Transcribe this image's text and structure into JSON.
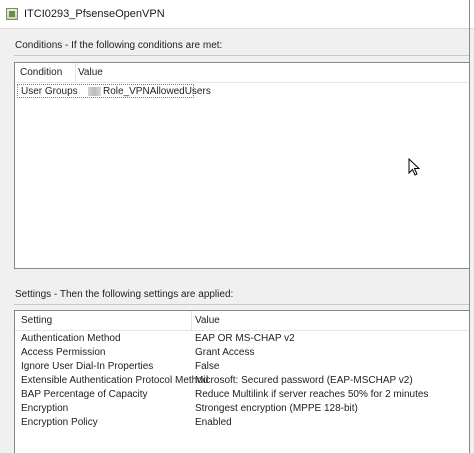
{
  "window": {
    "title": "ITCI0293_PfsenseOpenVPN"
  },
  "conditions": {
    "section_label": "Conditions - If the following conditions are met:",
    "columns": [
      "Condition",
      "Value"
    ],
    "rows": [
      {
        "condition": "User Groups",
        "value": "Role_VPNAllowedUsers"
      }
    ]
  },
  "settings": {
    "section_label": "Settings - Then the following settings are applied:",
    "columns": [
      "Setting",
      "Value"
    ],
    "rows": [
      {
        "setting": "Authentication Method",
        "value": "EAP OR MS-CHAP v2"
      },
      {
        "setting": "Access Permission",
        "value": "Grant Access"
      },
      {
        "setting": "Ignore User Dial-In Properties",
        "value": "False"
      },
      {
        "setting": "Extensible Authentication Protocol Method",
        "value": "Microsoft: Secured password (EAP-MSCHAP v2)"
      },
      {
        "setting": "BAP Percentage of Capacity",
        "value": "Reduce Multilink if server reaches 50% for 2 minutes"
      },
      {
        "setting": "Encryption",
        "value": "Strongest encryption (MPPE 128-bit)"
      },
      {
        "setting": "Encryption Policy",
        "value": "Enabled"
      }
    ]
  },
  "colors": {
    "background": "#f0f0f0",
    "listbox": "#ffffff",
    "border": "#828790"
  }
}
